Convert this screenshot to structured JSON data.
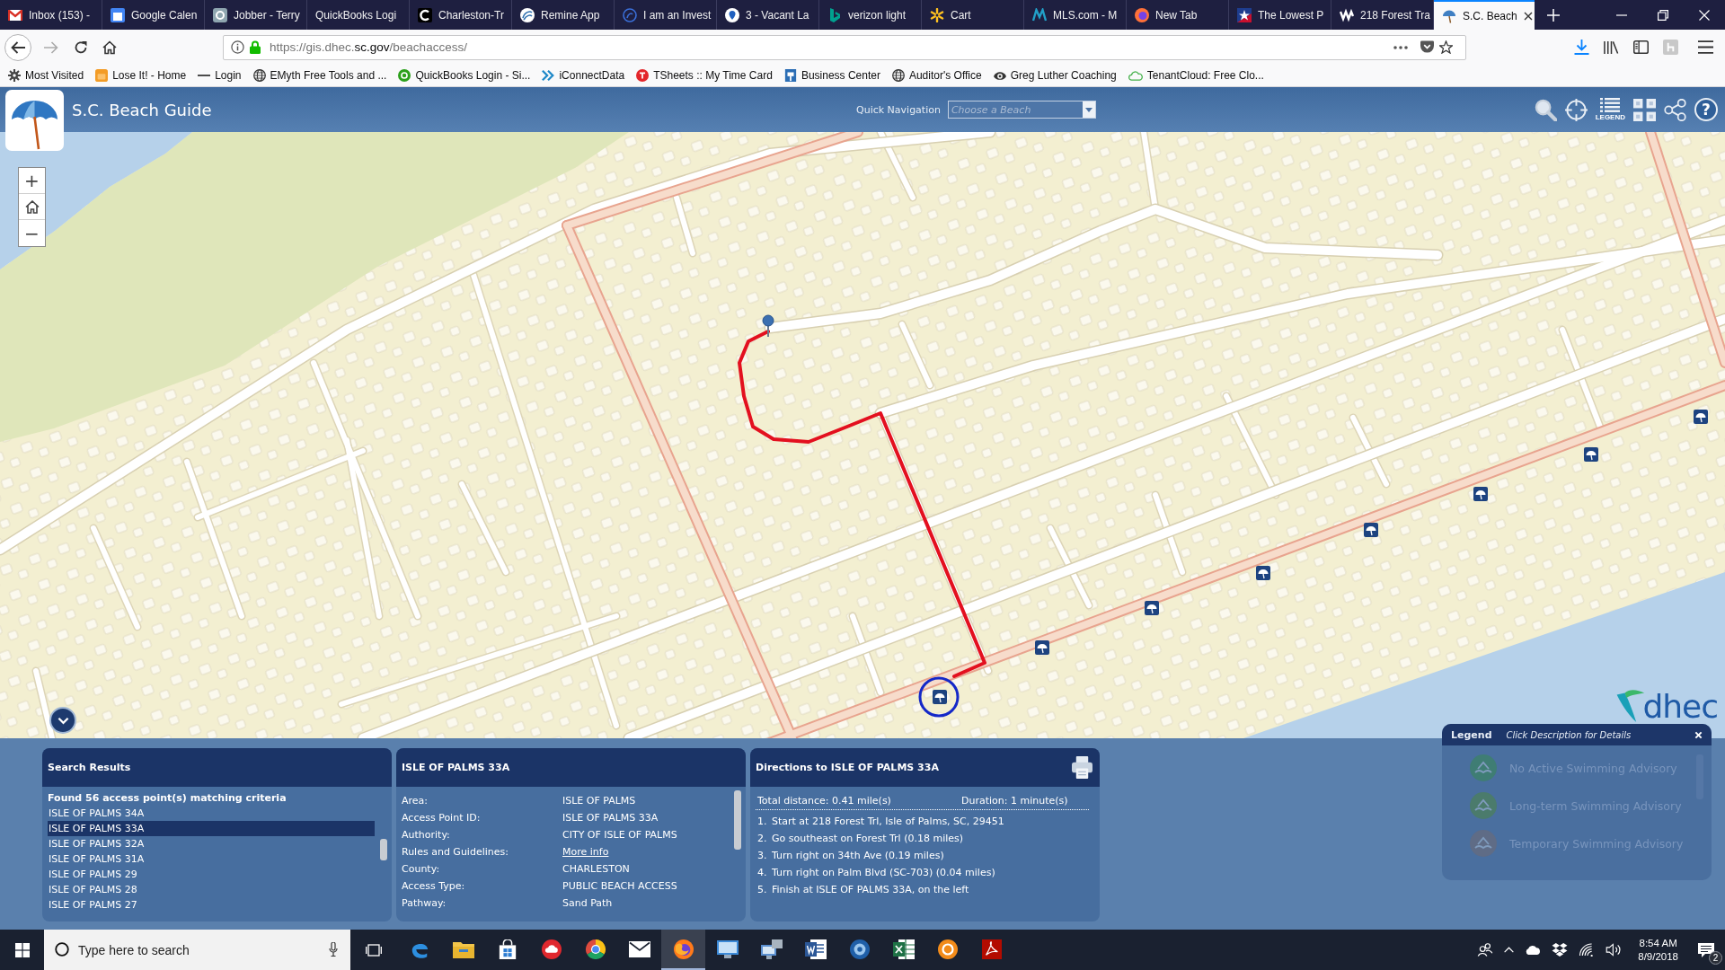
{
  "browser": {
    "tabs": [
      {
        "title": "Inbox (153) -",
        "kind": "mail",
        "selected": false
      },
      {
        "title": "Google Calen",
        "kind": "calendar",
        "selected": false
      },
      {
        "title": "Jobber - Terry",
        "kind": "circle",
        "selected": false
      },
      {
        "title": "QuickBooks Logi",
        "kind": "none",
        "selected": false
      },
      {
        "title": "Charleston-Tr",
        "kind": "arc",
        "selected": false
      },
      {
        "title": "Remine App",
        "kind": "swirl",
        "selected": false
      },
      {
        "title": "I am an Invest",
        "kind": "spiral",
        "selected": false
      },
      {
        "title": "3 - Vacant La",
        "kind": "pin",
        "selected": false
      },
      {
        "title": "verizon light",
        "kind": "flag",
        "selected": false
      },
      {
        "title": "Cart",
        "kind": "spark",
        "selected": false
      },
      {
        "title": "MLS.com - M",
        "kind": "zigzag",
        "selected": false
      },
      {
        "title": "New Tab",
        "kind": "flame",
        "selected": false
      },
      {
        "title": "The Lowest P",
        "kind": "star",
        "selected": false
      },
      {
        "title": "218 Forest Tra",
        "kind": "wave",
        "selected": false
      },
      {
        "title": "S.C. Beach",
        "kind": "umbrella",
        "selected": true
      }
    ],
    "address": {
      "segments": [
        {
          "text": "https://gis.dhec.",
          "kind": "muted"
        },
        {
          "text": "sc.gov",
          "kind": "host"
        },
        {
          "text": "/beachaccess/",
          "kind": "muted"
        }
      ]
    },
    "bookmarks": [
      {
        "label": "Most Visited",
        "kind": "gear"
      },
      {
        "label": "Lose It! - Home",
        "kind": "tile"
      },
      {
        "label": "Login",
        "kind": "dash"
      },
      {
        "label": "EMyth Free Tools and ...",
        "kind": "globe"
      },
      {
        "label": "QuickBooks Login - Si...",
        "kind": "disc"
      },
      {
        "label": "iConnectData",
        "kind": "zigzag"
      },
      {
        "label": "TSheets :: My Time Card",
        "kind": "badge"
      },
      {
        "label": "Business Center",
        "kind": "flag"
      },
      {
        "label": "Auditor's Office",
        "kind": "globe"
      },
      {
        "label": "Greg Luther Coaching",
        "kind": "eye"
      },
      {
        "label": "TenantCloud: Free Clo...",
        "kind": "cloud"
      }
    ]
  },
  "app": {
    "title": "S.C. Beach Guide",
    "quick_navigation": {
      "label": "Quick Navigation",
      "placeholder": "Choose a Beach"
    },
    "tools": [
      {
        "kind": "search"
      },
      {
        "kind": "locate"
      },
      {
        "kind": "legend",
        "label": "LEGEND"
      },
      {
        "kind": "grid"
      },
      {
        "kind": "share"
      },
      {
        "kind": "help",
        "label": "?"
      }
    ]
  },
  "map": {
    "zoom_controls": [
      {
        "kind": "zoom-in",
        "label": "+"
      },
      {
        "kind": "home"
      },
      {
        "kind": "zoom-out",
        "label": "−"
      }
    ],
    "logo": "dhec"
  },
  "search_results": {
    "title": "Search Results",
    "summary": "Found 56 access point(s) matching criteria",
    "items": [
      {
        "name": "ISLE OF PALMS 34A",
        "selected": false
      },
      {
        "name": "ISLE OF PALMS 33A",
        "selected": true
      },
      {
        "name": "ISLE OF PALMS 32A",
        "selected": false
      },
      {
        "name": "ISLE OF PALMS 31A",
        "selected": false
      },
      {
        "name": "ISLE OF PALMS 29",
        "selected": false
      },
      {
        "name": "ISLE OF PALMS 28",
        "selected": false
      },
      {
        "name": "ISLE OF PALMS 27",
        "selected": false
      }
    ]
  },
  "details": {
    "title": "ISLE OF PALMS 33A",
    "rows": [
      {
        "label": "Area:",
        "value": "ISLE OF PALMS",
        "kind": "text"
      },
      {
        "label": "Access Point ID:",
        "value": "ISLE OF PALMS 33A",
        "kind": "text"
      },
      {
        "label": "Authority:",
        "value": "CITY OF ISLE OF PALMS",
        "kind": "text"
      },
      {
        "label": "Rules and Guidelines:",
        "value": "More info",
        "kind": "link"
      },
      {
        "label": "County:",
        "value": "CHARLESTON",
        "kind": "text"
      },
      {
        "label": "Access Type:",
        "value": "PUBLIC BEACH ACCESS",
        "kind": "text"
      },
      {
        "label": "Pathway:",
        "value": "Sand Path",
        "kind": "text"
      }
    ]
  },
  "directions": {
    "title": "Directions to ISLE OF PALMS 33A",
    "total_distance": "Total distance: 0.41 mile(s)",
    "duration": "Duration: 1 minute(s)",
    "steps": [
      {
        "number": "1.",
        "text": "Start at 218 Forest Trl, Isle of Palms, SC, 29451"
      },
      {
        "number": "2.",
        "text": "Go southeast on Forest Trl (0.18 miles)"
      },
      {
        "number": "3.",
        "text": "Turn right on 34th Ave (0.19 miles)"
      },
      {
        "number": "4.",
        "text": "Turn right on Palm Blvd (SC-703) (0.04 miles)"
      },
      {
        "number": "5.",
        "text": "Finish at ISLE OF PALMS 33A, on the left"
      }
    ]
  },
  "legend": {
    "title": "Legend",
    "hint": "Click Description for Details",
    "items": [
      {
        "label": "No Active Swimming Advisory",
        "color": "#3f7d74"
      },
      {
        "label": "Long-term Swimming Advisory",
        "color": "#4b7b6c"
      },
      {
        "label": "Temporary Swimming Advisory",
        "color": "#5f6c86"
      }
    ]
  },
  "taskbar": {
    "search_placeholder": "Type here to search",
    "apps": [
      {
        "kind": "edge",
        "selected": false
      },
      {
        "kind": "folder",
        "selected": false
      },
      {
        "kind": "store",
        "selected": false
      },
      {
        "kind": "cloud",
        "selected": false
      },
      {
        "kind": "chrome",
        "selected": false
      },
      {
        "kind": "mail",
        "selected": false
      },
      {
        "kind": "firefox",
        "selected": true
      },
      {
        "kind": "window",
        "selected": false
      },
      {
        "kind": "remote",
        "selected": false
      },
      {
        "kind": "word",
        "selected": false
      },
      {
        "kind": "disc",
        "selected": false
      },
      {
        "kind": "excel",
        "selected": false
      },
      {
        "kind": "orange",
        "selected": false
      },
      {
        "kind": "pdf",
        "selected": false
      }
    ],
    "clock": {
      "time": "8:54 AM",
      "date": "8/9/2018"
    },
    "notifications": "2"
  }
}
